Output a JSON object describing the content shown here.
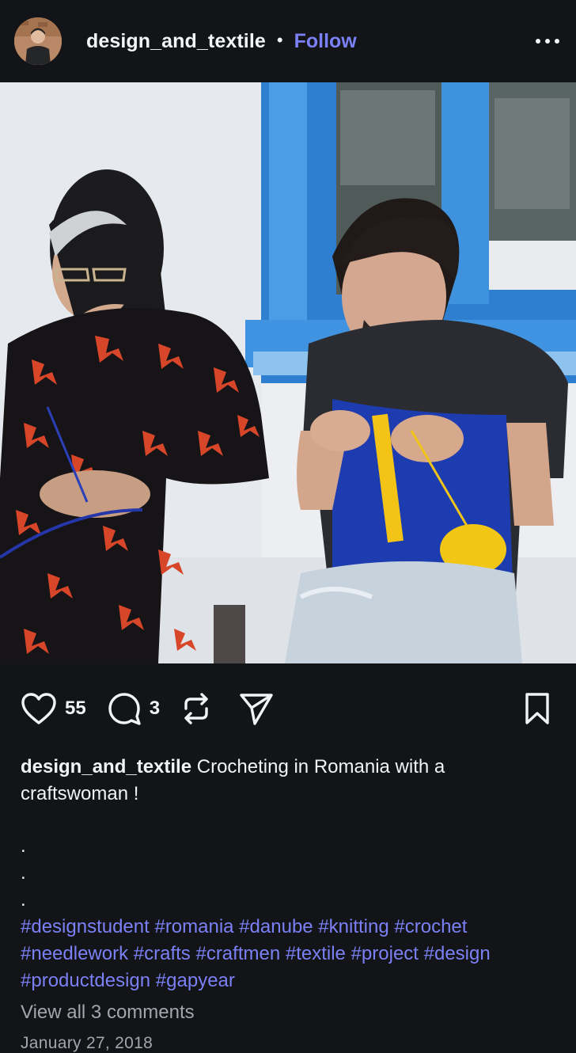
{
  "header": {
    "username": "design_and_textile",
    "separator": "•",
    "follow_label": "Follow",
    "more_icon": "more-horizontal-icon"
  },
  "photo": {
    "image_name": "photo"
  },
  "actions": {
    "likes": "55",
    "comments": "3",
    "like_icon": "heart-icon",
    "comment_icon": "comment-icon",
    "repost_icon": "repost-icon",
    "share_icon": "send-icon",
    "save_icon": "bookmark-icon"
  },
  "caption": {
    "username": "design_and_textile",
    "text": " Crocheting in Romania with a craftswoman !",
    "dots": [
      ".",
      ".",
      "."
    ]
  },
  "hashtags": [
    "#designstudent",
    "#romania",
    "#danube",
    "#knitting",
    "#crochet",
    "#needlework",
    "#crafts",
    "#craftmen",
    "#textile",
    "#project",
    "#design",
    "#productdesign",
    "#gapyear"
  ],
  "view_comments": "View all 3 comments",
  "date": "January 27, 2018",
  "colors": {
    "background": "#121417",
    "accent": "#7b80f5",
    "muted": "#a2a6ad"
  }
}
